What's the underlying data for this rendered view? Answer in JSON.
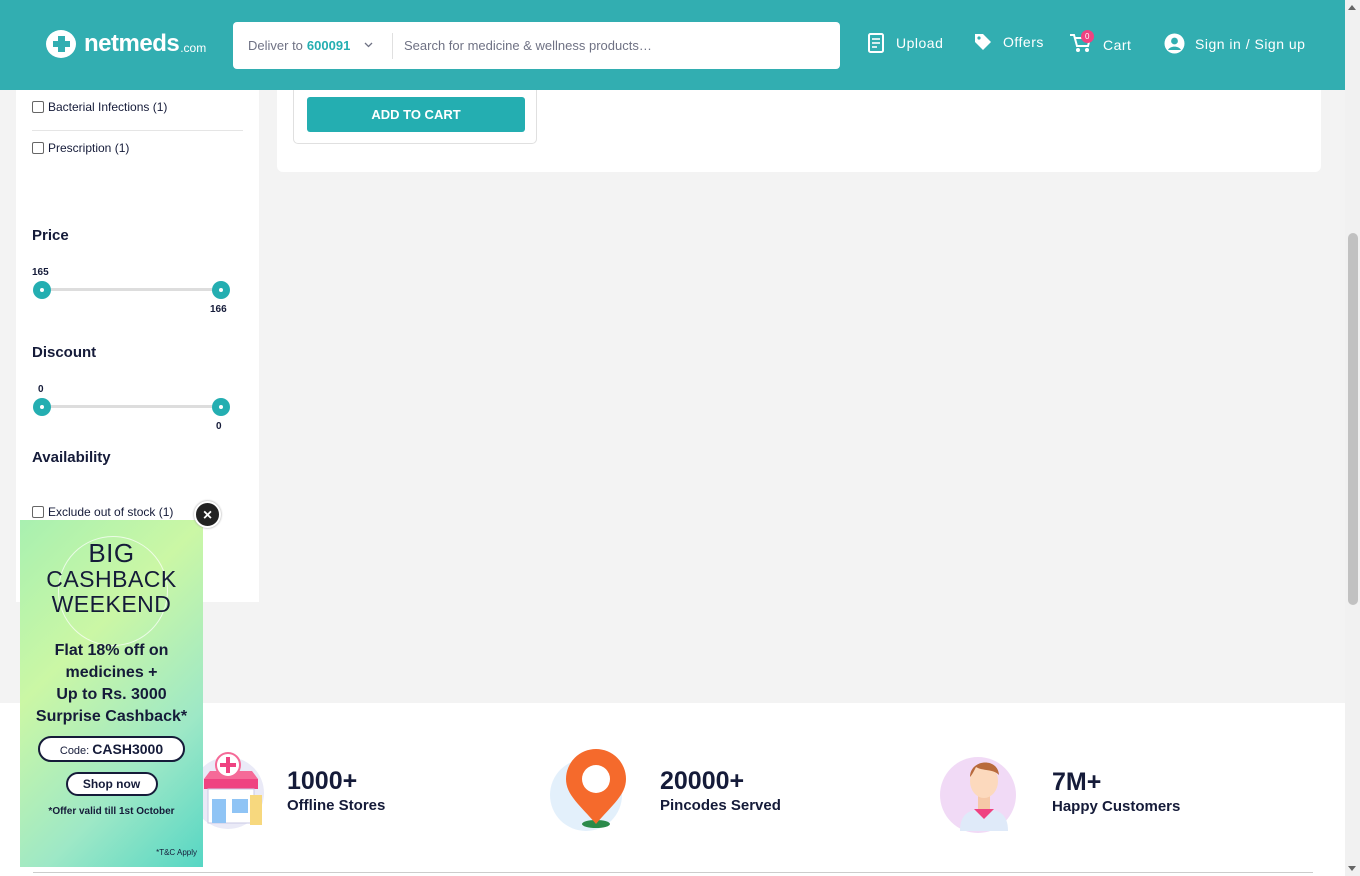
{
  "header": {
    "logo_text": "netmeds",
    "logo_suffix": ".com",
    "deliver_label": "Deliver to",
    "pincode": "600091",
    "search_placeholder": "Search for medicine & wellness products…",
    "upload_label": "Upload",
    "offers_label": "Offers",
    "cart_label": "Cart",
    "cart_count": "0",
    "signin_label": "Sign in / Sign up"
  },
  "filters": {
    "categories": [
      {
        "label": "Bacterial Infections (1)"
      },
      {
        "label": "Prescription (1)"
      }
    ],
    "price": {
      "title": "Price",
      "min": "165",
      "max": "166"
    },
    "discount": {
      "title": "Discount",
      "min": "0",
      "max": "0"
    },
    "availability": {
      "title": "Availability",
      "option": "Exclude out of stock (1)"
    }
  },
  "product": {
    "add_to_cart": "ADD TO CART"
  },
  "stats": [
    {
      "num": "1000+",
      "label": "Offline Stores"
    },
    {
      "num": "20000+",
      "label": "Pincodes Served"
    },
    {
      "num": "7M+",
      "label": "Happy Customers"
    }
  ],
  "promo": {
    "heading_1": "BIG",
    "heading_2": "CASHBACK",
    "heading_3": "WEEKEND",
    "body_1": "Flat 18% off on",
    "body_2": "medicines +",
    "body_3": "Up to Rs. 3000",
    "body_4": "Surprise Cashback*",
    "code_label": "Code:",
    "code": "CASH3000",
    "shop_label": "Shop now",
    "validity": "*Offer valid till 1st October",
    "tc": "*T&C Apply",
    "close_glyph": "×"
  },
  "colors": {
    "brand": "#32aeb1",
    "accent": "#24aeb1",
    "badge": "#ef4281",
    "text": "#151b39"
  }
}
